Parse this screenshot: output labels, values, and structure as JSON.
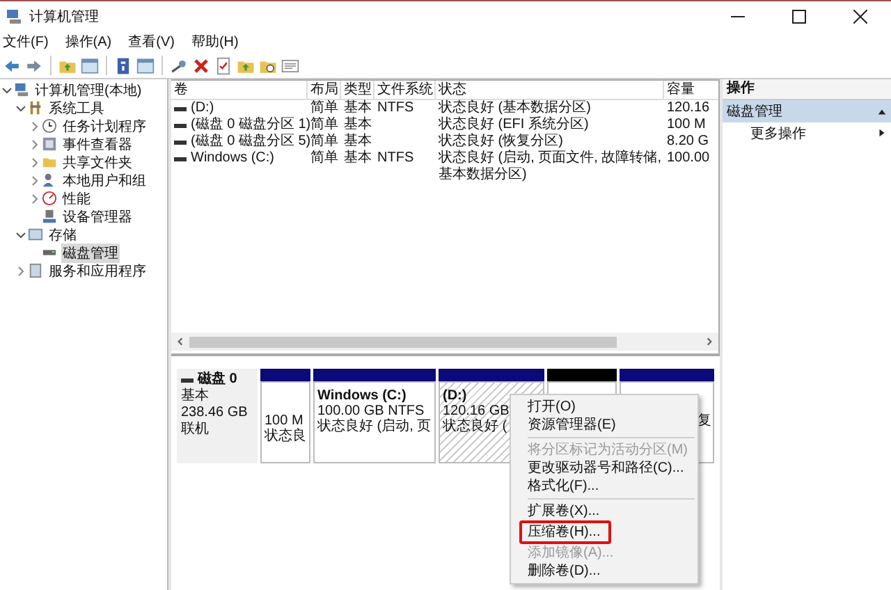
{
  "window": {
    "title": "计算机管理"
  },
  "menu": [
    "文件(F)",
    "操作(A)",
    "查看(V)",
    "帮助(H)"
  ],
  "toolbar": [
    {
      "kind": "back"
    },
    {
      "kind": "forward"
    },
    {
      "kind": "sep"
    },
    {
      "kind": "folder-up"
    },
    {
      "kind": "pane"
    },
    {
      "kind": "sep"
    },
    {
      "kind": "help"
    },
    {
      "kind": "pane"
    },
    {
      "kind": "sep"
    },
    {
      "kind": "key"
    },
    {
      "kind": "delete"
    },
    {
      "kind": "check"
    },
    {
      "kind": "folder-up"
    },
    {
      "kind": "folder-search"
    },
    {
      "kind": "list"
    }
  ],
  "tree": [
    {
      "label": "计算机管理(本地)",
      "kind": "computer",
      "expanded": true,
      "selected": false,
      "children": [
        {
          "label": "系统工具",
          "kind": "tools",
          "expanded": true,
          "selected": false,
          "children": [
            {
              "label": "任务计划程序",
              "kind": "clock",
              "expanded": false,
              "selected": false
            },
            {
              "label": "事件查看器",
              "kind": "log",
              "expanded": false,
              "selected": false
            },
            {
              "label": "共享文件夹",
              "kind": "folder",
              "expanded": false,
              "selected": false
            },
            {
              "label": "本地用户和组",
              "kind": "users",
              "expanded": false,
              "selected": false
            },
            {
              "label": "性能",
              "kind": "gauge",
              "expanded": false,
              "selected": false
            },
            {
              "label": "设备管理器",
              "kind": "device",
              "selected": false
            }
          ]
        },
        {
          "label": "存储",
          "kind": "storage",
          "expanded": true,
          "selected": false,
          "children": [
            {
              "label": "磁盘管理",
              "kind": "disk",
              "selected": true
            }
          ]
        },
        {
          "label": "服务和应用程序",
          "kind": "services",
          "expanded": false,
          "selected": false
        }
      ]
    }
  ],
  "table": {
    "columns": [
      "卷",
      "布局",
      "类型",
      "文件系统",
      "状态",
      "容量"
    ],
    "rows": [
      [
        "(D:)",
        "简单",
        "基本",
        "NTFS",
        "状态良好 (基本数据分区)",
        "120.16"
      ],
      [
        "(磁盘 0 磁盘分区 1)",
        "简单",
        "基本",
        "",
        "状态良好 (EFI 系统分区)",
        "100 M"
      ],
      [
        "(磁盘 0 磁盘分区 5)",
        "简单",
        "基本",
        "",
        "状态良好 (恢复分区)",
        "8.20 G"
      ],
      [
        "Windows (C:)",
        "简单",
        "基本",
        "NTFS",
        "状态良好 (启动, 页面文件, 故障转储, 基本数据分区)",
        "100.00"
      ]
    ]
  },
  "disk": {
    "name": "磁盘 0",
    "lines": [
      "基本",
      "238.46 GB",
      "联机"
    ],
    "partitions": [
      {
        "kind": "primary",
        "selected": false,
        "lines": [
          "100 M",
          "状态良"
        ]
      },
      {
        "kind": "primary",
        "selected": false,
        "title": "Windows  (C:)",
        "lines": [
          "100.00 GB NTFS",
          "状态良好 (启动, 页"
        ]
      },
      {
        "kind": "primary",
        "selected": true,
        "title": "(D:)",
        "lines": [
          "120.16 GB",
          "状态良好 ("
        ]
      },
      {
        "kind": "unallocated",
        "selected": false
      },
      {
        "kind": "primary",
        "selected": false,
        "lines": [
          "复"
        ]
      }
    ]
  },
  "actions": {
    "title": "操作",
    "section": "磁盘管理",
    "items": [
      "更多操作"
    ]
  },
  "context_menu": [
    {
      "kind": "item",
      "label": "打开(O)",
      "disabled": false,
      "highlighted": false
    },
    {
      "kind": "item",
      "label": "资源管理器(E)",
      "disabled": false,
      "highlighted": false
    },
    {
      "kind": "sep"
    },
    {
      "kind": "item",
      "label": "将分区标记为活动分区(M)",
      "disabled": true,
      "highlighted": false
    },
    {
      "kind": "item",
      "label": "更改驱动器号和路径(C)...",
      "disabled": false,
      "highlighted": false
    },
    {
      "kind": "item",
      "label": "格式化(F)...",
      "disabled": false,
      "highlighted": false
    },
    {
      "kind": "sep"
    },
    {
      "kind": "item",
      "label": "扩展卷(X)...",
      "disabled": false,
      "highlighted": false
    },
    {
      "kind": "item",
      "label": "压缩卷(H)...",
      "disabled": false,
      "highlighted": true
    },
    {
      "kind": "item",
      "label": "添加镜像(A)...",
      "disabled": true,
      "highlighted": false
    },
    {
      "kind": "item",
      "label": "删除卷(D)...",
      "disabled": false,
      "highlighted": false
    }
  ]
}
